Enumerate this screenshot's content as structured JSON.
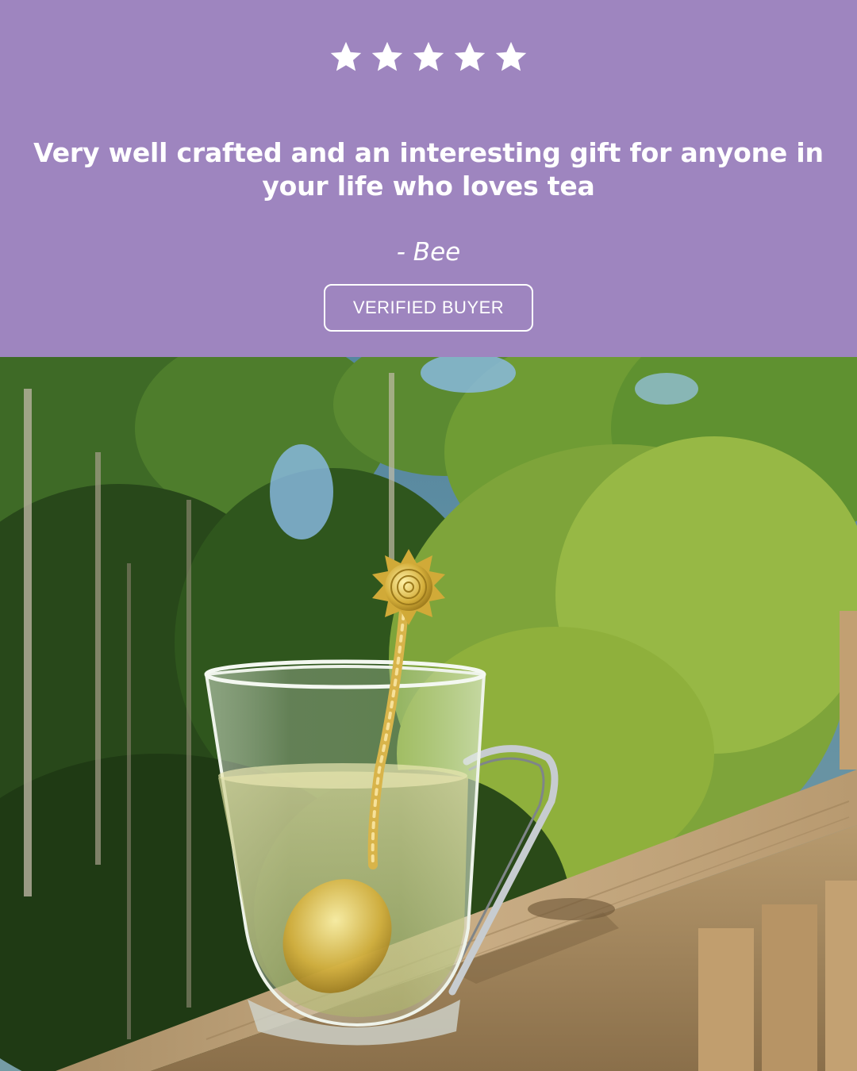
{
  "review": {
    "rating": 5,
    "rating_max": 5,
    "quote": "Very well crafted and an interesting gift for anyone in your life who loves tea",
    "author": "- Bee",
    "badge": "VERIFIED BUYER"
  },
  "colors": {
    "panel_background": "#9e85bf",
    "text": "#ffffff"
  },
  "photo": {
    "subject": "glass-tea-cup-with-sun-spoon"
  }
}
